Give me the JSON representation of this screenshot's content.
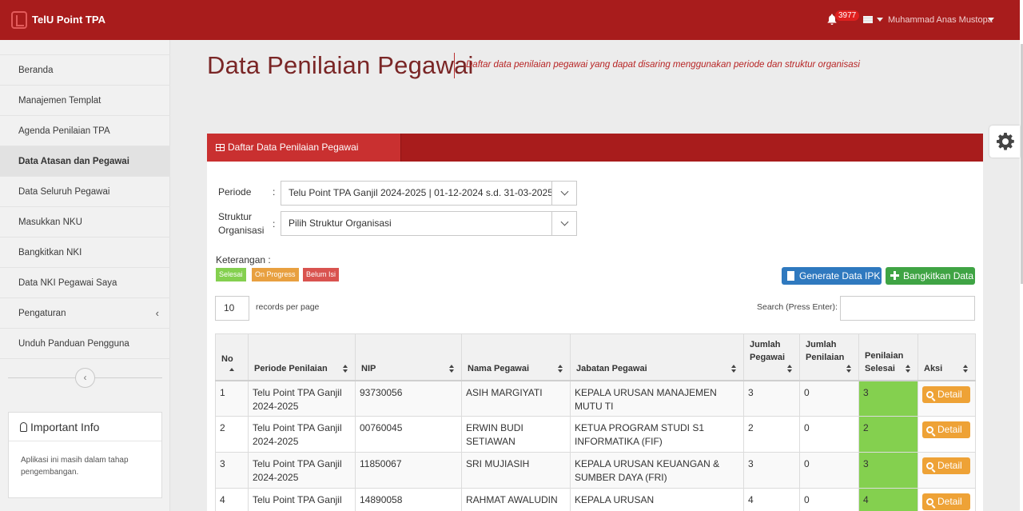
{
  "app": {
    "title": "TelU Point TPA"
  },
  "topbar": {
    "notification_count": "3977",
    "user_name": "Muhammad Anas Mustopa"
  },
  "sidebar": {
    "items": [
      {
        "label": "Beranda"
      },
      {
        "label": "Manajemen Templat"
      },
      {
        "label": "Agenda Penilaian TPA"
      },
      {
        "label": "Data Atasan dan Pegawai",
        "active": true
      },
      {
        "label": "Data Seluruh Pegawai"
      },
      {
        "label": "Masukkan NKU"
      },
      {
        "label": "Bangkitkan NKI"
      },
      {
        "label": "Data NKI Pegawai Saya"
      },
      {
        "label": "Pengaturan"
      },
      {
        "label": "Unduh Panduan Pengguna"
      }
    ],
    "info": {
      "title": "Important Info",
      "text": "Aplikasi ini masih dalam tahap pengembangan."
    }
  },
  "page": {
    "title": "Data Penilaian Pegawai",
    "subtitle": "Daftar data penilaian pegawai yang dapat disaring menggunakan periode dan struktur organisasi"
  },
  "panel": {
    "tab": "Daftar Data Penilaian Pegawai",
    "filters": {
      "periode_label": "Periode",
      "periode_value": "Telu Point TPA Ganjil 2024-2025 | 01-12-2024 s.d. 31-03-2025",
      "struktur_label_1": "Struktur",
      "struktur_label_2": "Organisasi",
      "struktur_value": "Pilih Struktur Organisasi",
      "colon": ":"
    },
    "legend": {
      "label": "Keterangan :",
      "selesai": "Selesai",
      "progress": "On Progress",
      "belum": "Belum Isi"
    },
    "buttons": {
      "generate": "Generate Data IPK",
      "bangkitkan": "Bangkitkan Data"
    },
    "table_controls": {
      "length": "10",
      "length_label": "records per page",
      "search_label": "Search (Press Enter):"
    },
    "table": {
      "headers": {
        "no": "No",
        "periode": "Periode Penilaian",
        "nip": "NIP",
        "nama": "Nama Pegawai",
        "jabatan": "Jabatan Pegawai",
        "jumlah_pegawai_1": "Jumlah",
        "jumlah_pegawai_2": "Pegawai",
        "jumlah_penilaian_1": "Jumlah",
        "jumlah_penilaian_2": "Penilaian",
        "selesai_1": "Penilaian",
        "selesai_2": "Selesai",
        "aksi": "Aksi"
      },
      "rows": [
        {
          "no": "1",
          "periode_1": "Telu Point TPA Ganjil",
          "periode_2": "2024-2025",
          "nip": "93730056",
          "nama_1": "ASIH MARGIYATI",
          "nama_2": "",
          "jabatan_1": "KEPALA URUSAN MANAJEMEN",
          "jabatan_2": "MUTU TI",
          "jumlah_pegawai": "3",
          "jumlah_penilaian": "0",
          "selesai": "3",
          "aksi": "Detail"
        },
        {
          "no": "2",
          "periode_1": "Telu Point TPA Ganjil",
          "periode_2": "2024-2025",
          "nip": "00760045",
          "nama_1": "ERWIN BUDI",
          "nama_2": "SETIAWAN",
          "jabatan_1": "KETUA PROGRAM STUDI S1",
          "jabatan_2": "INFORMATIKA (FIF)",
          "jumlah_pegawai": "2",
          "jumlah_penilaian": "0",
          "selesai": "2",
          "aksi": "Detail"
        },
        {
          "no": "3",
          "periode_1": "Telu Point TPA Ganjil",
          "periode_2": "2024-2025",
          "nip": "11850067",
          "nama_1": "SRI MUJIASIH",
          "nama_2": "",
          "jabatan_1": "KEPALA URUSAN KEUANGAN &",
          "jabatan_2": "SUMBER DAYA (FRI)",
          "jumlah_pegawai": "3",
          "jumlah_penilaian": "0",
          "selesai": "3",
          "aksi": "Detail"
        },
        {
          "no": "4",
          "periode_1": "Telu Point TPA Ganjil",
          "periode_2": "",
          "nip": "14890058",
          "nama_1": "RAHMAT AWALUDIN",
          "nama_2": "",
          "jabatan_1": "KEPALA URUSAN",
          "jabatan_2": "",
          "jumlah_pegawai": "4",
          "jumlah_penilaian": "0",
          "selesai": "4",
          "aksi": "Detail"
        }
      ]
    }
  },
  "colors": {
    "topbar": "#a81c1c",
    "panel_tab": "#c93030",
    "selesai": "#84d04f",
    "progress": "#e8a040",
    "belum": "#d9534f",
    "generate_btn": "#2f79bf",
    "bangkitkan_btn": "#3fa444",
    "detail_btn": "#eea236"
  },
  "icons": [
    "bell-icon",
    "flag-icon",
    "gear-icon",
    "table-icon",
    "file-icon",
    "plus-icon",
    "search-icon",
    "lightbulb-icon",
    "chevron-left-icon"
  ]
}
